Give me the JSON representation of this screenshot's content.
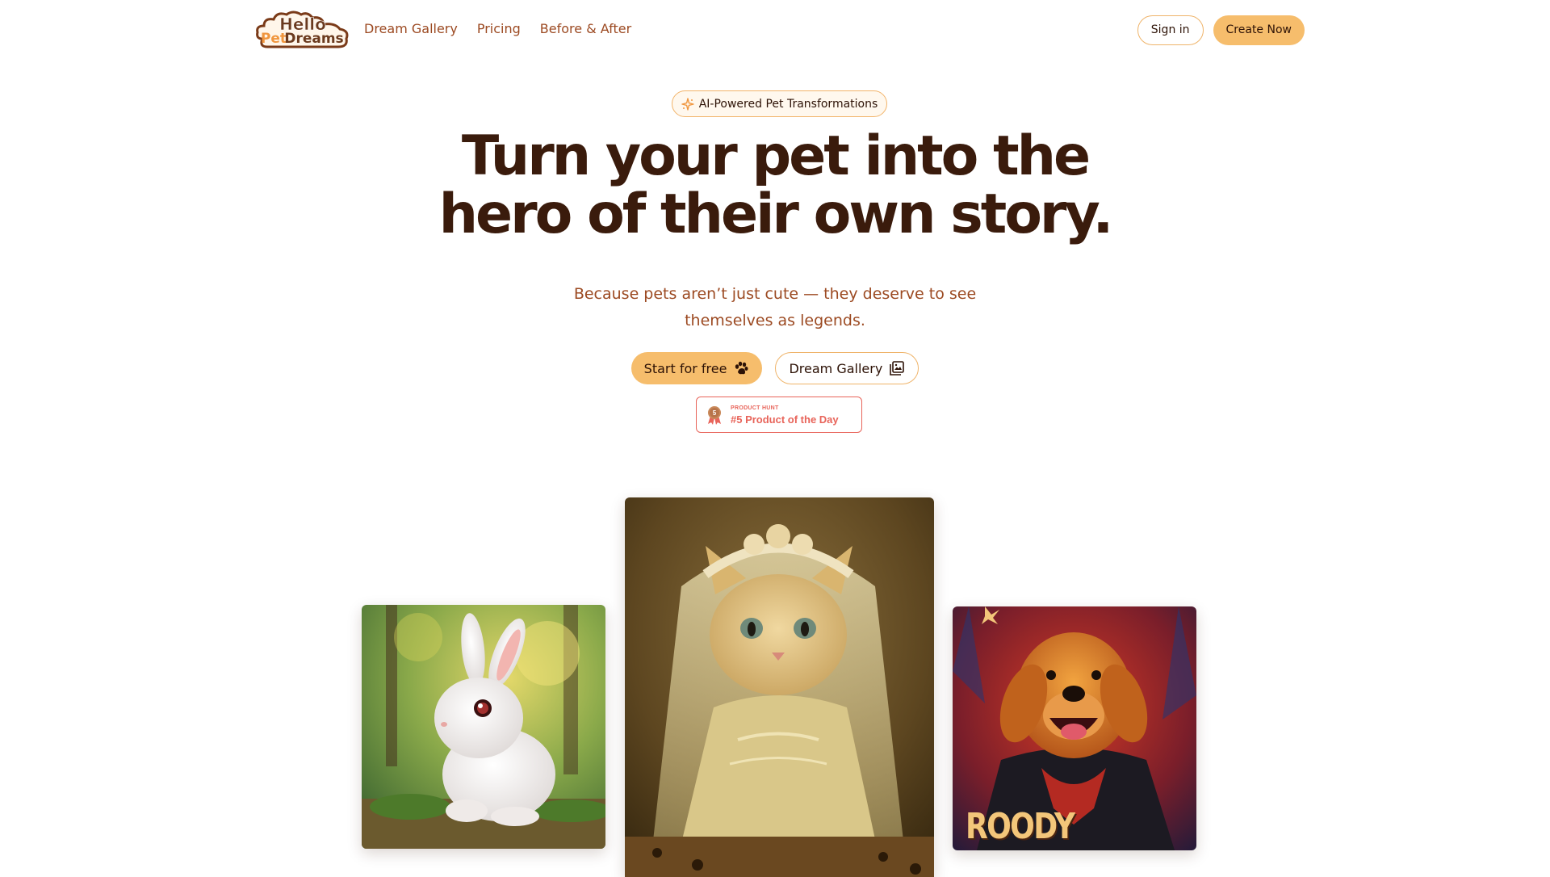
{
  "nav": {
    "logo_line1": "Hello",
    "logo_line2_a": "Pet",
    "logo_line2_b": "Dreams",
    "links": [
      "Dream Gallery",
      "Pricing",
      "Before & After"
    ],
    "sign_in": "Sign in",
    "create_now": "Create Now"
  },
  "hero": {
    "badge": "AI-Powered Pet Transformations",
    "headline_line1": "Turn your pet into the",
    "headline_line2": "hero of their own story.",
    "subline_line1": "Because pets aren’t just cute — they deserve to see",
    "subline_line2": "themselves as legends.",
    "start_button": "Start for free",
    "gallery_button": "Dream Gallery",
    "product_hunt_label": "PRODUCT HUNT",
    "product_hunt_title": "#5 Product of the Day",
    "product_hunt_rank": "5"
  },
  "gallery": {
    "dog_caption": "ROODY"
  },
  "colors": {
    "accent": "#f6bd6c",
    "link": "#9c4a22",
    "heading": "#3a1b0c",
    "product_hunt": "#e8645a"
  },
  "icons": [
    "sparkle-icon",
    "paw-icon",
    "gallery-icon",
    "medal-icon"
  ]
}
